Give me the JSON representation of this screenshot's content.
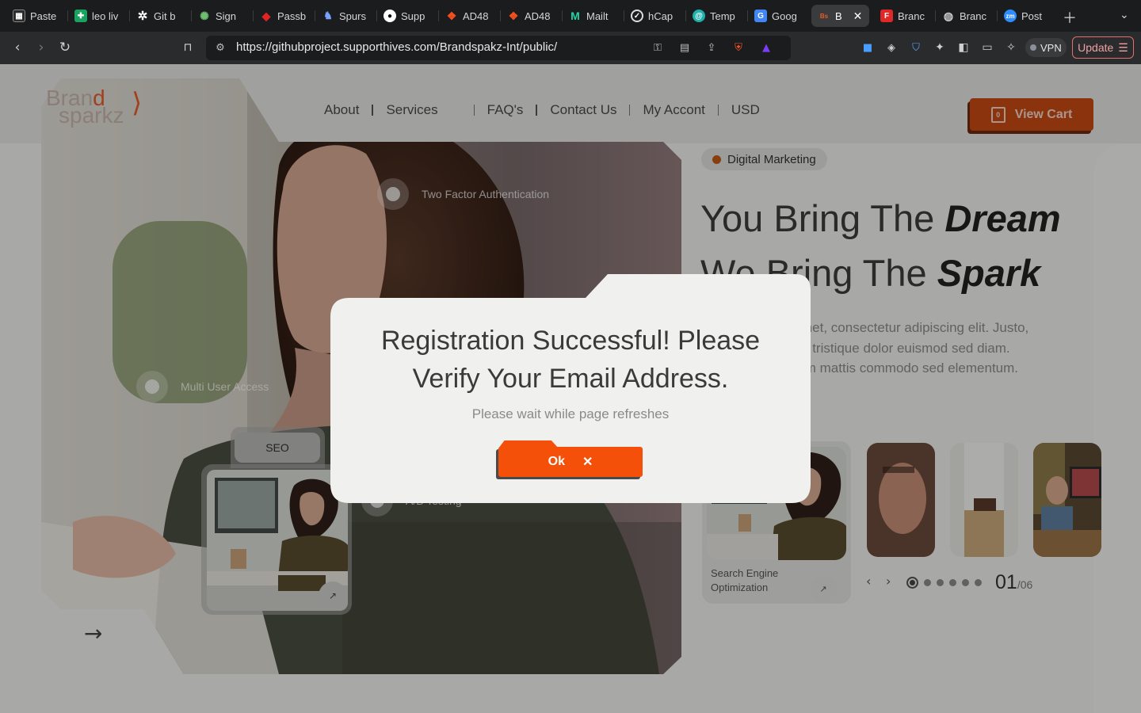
{
  "browser": {
    "tabs": [
      {
        "label": "Paste",
        "icon": "paste-icon",
        "color": "#ffffff"
      },
      {
        "label": "leo liv",
        "icon": "sheets-icon",
        "color": "#1aa260"
      },
      {
        "label": "Git b",
        "icon": "gear-icon",
        "color": "#ffffff"
      },
      {
        "label": "Sign",
        "icon": "puzzle-icon",
        "color": "#6cc070"
      },
      {
        "label": "Passb",
        "icon": "passbolt-icon",
        "color": "#e02424"
      },
      {
        "label": "Spurs",
        "icon": "spurs-icon",
        "color": "#7aa0ff"
      },
      {
        "label": "Supp",
        "icon": "github-icon",
        "color": "#ffffff"
      },
      {
        "label": "AD48",
        "icon": "figma-icon",
        "color": "#f24e1e"
      },
      {
        "label": "AD48",
        "icon": "figma-icon",
        "color": "#f24e1e"
      },
      {
        "label": "Mailt",
        "icon": "mailtrap-icon",
        "color": "#22d3a6"
      },
      {
        "label": "hCap",
        "icon": "hcaptcha-icon",
        "color": "#ffffff"
      },
      {
        "label": "Temp",
        "icon": "temp-mail-icon",
        "color": "#20b2aa"
      },
      {
        "label": "Goog",
        "icon": "google-translate-icon",
        "color": "#4285f4"
      },
      {
        "label": "B",
        "icon": "brandsparkz-icon",
        "color": "#e85c2a"
      },
      {
        "label": "Branc",
        "icon": "flipboard-icon",
        "color": "#e12828"
      },
      {
        "label": "Branc",
        "icon": "globe-icon",
        "color": "#cccccc"
      },
      {
        "label": "Post",
        "icon": "zoom-icon",
        "color": "#2d8cff"
      }
    ],
    "active_tab": 13,
    "url": "https://githubproject.supporthives.com/Brandspakz-Int/public/",
    "vpn_label": "VPN",
    "update_label": "Update"
  },
  "site": {
    "logo": {
      "line1a": "Bran",
      "line1b": "d",
      "line2": "sparkz"
    },
    "nav": [
      "About",
      "Services",
      "FAQ's",
      "Contact Us",
      "My Accont",
      "USD"
    ],
    "cart_label": "View Cart",
    "cart_count": "0",
    "badge": "Digital Marketing",
    "headline": {
      "line1_plain": "You Bring The ",
      "line1_em": "Dream",
      "line2_plain": "We Bring The ",
      "line2_em": "Spark"
    },
    "lorem": [
      "or sit amet, consectetur adipiscing elit. Justo,",
      "el, amet tristique dolor euismod sed diam.",
      "titor diam mattis commodo sed elementum."
    ],
    "features": {
      "two_factor": "Two Factor Authentication",
      "multi_user": "Multi User Access",
      "ab_testing": "A/B Testing"
    },
    "seo_card": {
      "label": "SEO"
    },
    "service_label": "Search Engine Optimization",
    "counter": {
      "current": "01",
      "total": "/06"
    }
  },
  "modal": {
    "title_line1": "Registration Successful! Please",
    "title_line2": "Verify Your Email Address.",
    "subtitle": "Please wait while page refreshes",
    "ok_label": "Ok",
    "ok_icon": "close-icon"
  },
  "colors": {
    "accent": "#f5500a",
    "cart": "#c84a14",
    "overlay": "rgba(0,0,0,0.3)"
  }
}
